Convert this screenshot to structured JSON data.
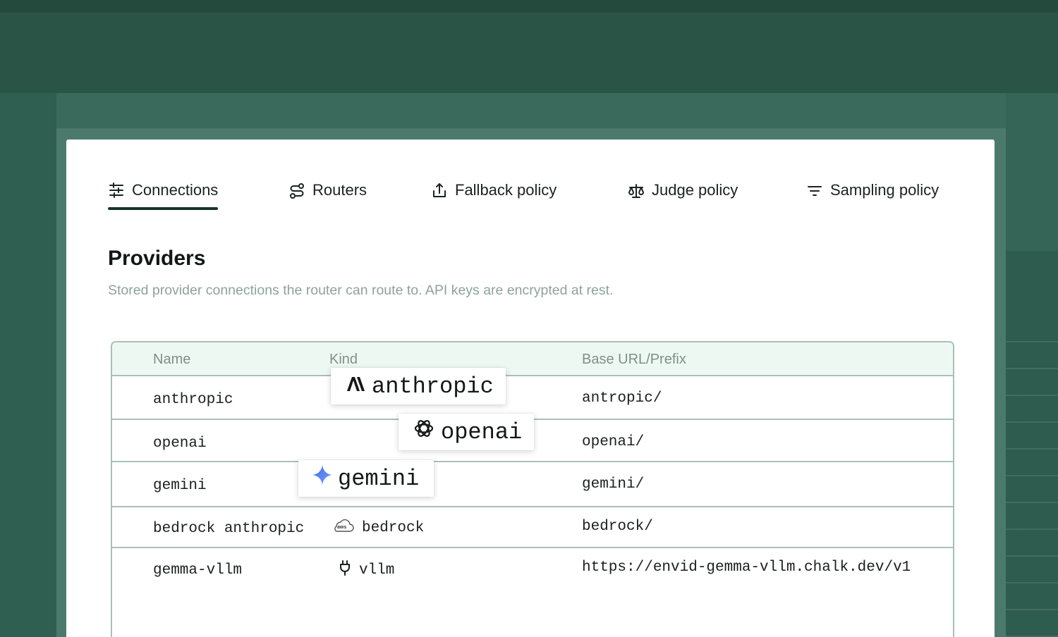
{
  "tabs": [
    {
      "label": "Connections",
      "icon": "sliders-icon",
      "active": true
    },
    {
      "label": "Routers",
      "icon": "route-icon",
      "active": false
    },
    {
      "label": "Fallback policy",
      "icon": "share-upload-icon",
      "active": false
    },
    {
      "label": "Judge policy",
      "icon": "scale-icon",
      "active": false
    },
    {
      "label": "Sampling policy",
      "icon": "filter-icon",
      "active": false
    }
  ],
  "section": {
    "title": "Providers",
    "description": "Stored provider connections the router can route to. API keys are encrypted at rest."
  },
  "table": {
    "columns": [
      "Name",
      "Kind",
      "Base URL/Prefix"
    ],
    "rows": [
      {
        "name": "anthropic",
        "kind": "anthropic",
        "kind_icon": "anthropic-logo-icon",
        "base": "antropic/"
      },
      {
        "name": "openai",
        "kind": "openai",
        "kind_icon": "openai-logo-icon",
        "base": "openai/"
      },
      {
        "name": "gemini",
        "kind": "gemini",
        "kind_icon": "gemini-sparkle-icon",
        "base": "gemini/"
      },
      {
        "name": "bedrock anthropic",
        "kind": "bedrock",
        "kind_icon": "aws-cloud-icon",
        "base": "bedrock/"
      },
      {
        "name": "gemma-vllm",
        "kind": "vllm",
        "kind_icon": "plug-icon",
        "base": "https://envid-gemma-vllm.chalk.dev/v1"
      }
    ]
  },
  "colors": {
    "background": "#2f5c4f",
    "accent": "#16332b",
    "table_header_bg": "#eef8f2",
    "border": "#a9c1b7",
    "muted_text": "#8ea39b",
    "gemini_blue": "#4a7cf0"
  }
}
